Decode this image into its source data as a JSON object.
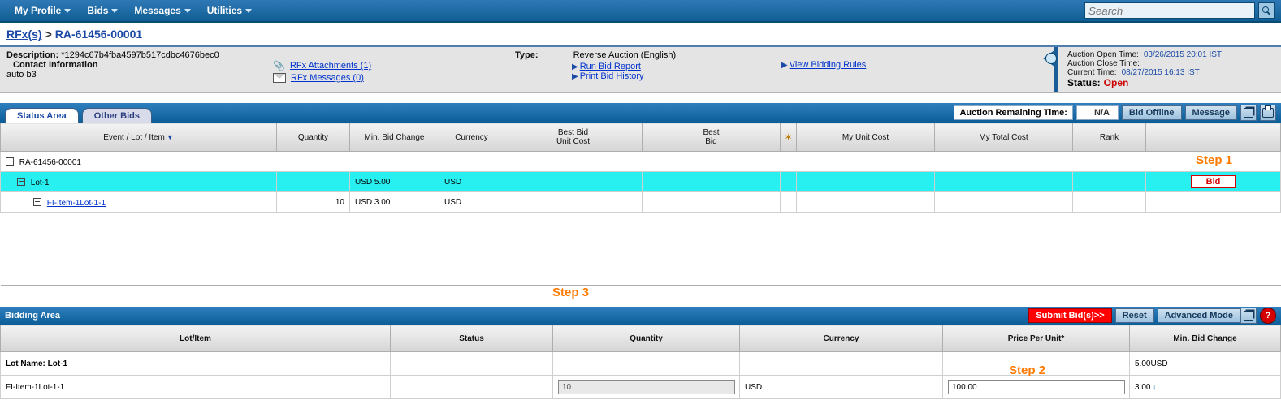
{
  "topnav": {
    "items": [
      "My Profile",
      "Bids",
      "Messages",
      "Utilities"
    ],
    "search_placeholder": "Search"
  },
  "breadcrumb": {
    "link": "RFx(s)",
    "current": "RA-61456-00001"
  },
  "info": {
    "description_label": "Description:",
    "description_value": "*1294c67b4fba4597b517cdbc4676bec0",
    "contact_label": "Contact Information",
    "contact_value": "auto b3",
    "rfx_attachments": "RFx Attachments (1)",
    "rfx_messages": "RFx Messages (0)",
    "type_label": "Type:",
    "type_value": "Reverse Auction (English)",
    "run_bid_report": "Run Bid Report",
    "print_bid_history": "Print Bid History",
    "view_bidding_rules": "View Bidding Rules"
  },
  "times": {
    "open_label": "Auction Open Time:",
    "open_value": "03/26/2015 20:01 IST",
    "close_label": "Auction Close Time:",
    "close_value": "",
    "current_label": "Current Time:",
    "current_value": "08/27/2015 16:13 IST",
    "status_label": "Status:",
    "status_value": "Open"
  },
  "tabs": {
    "status_area": "Status Area",
    "other_bids": "Other Bids"
  },
  "toolbar": {
    "remaining_label": "Auction Remaining Time:",
    "remaining_value": "N/A",
    "bid_offline": "Bid Offline",
    "message": "Message"
  },
  "grid": {
    "headers": {
      "event": "Event / Lot / Item",
      "quantity": "Quantity",
      "min_bid_change": "Min. Bid Change",
      "currency": "Currency",
      "best_bid_unit": "Best Bid\nUnit Cost",
      "best_bid": "Best\nBid",
      "my_unit": "My Unit Cost",
      "my_total": "My Total Cost",
      "rank": "Rank"
    },
    "rows": {
      "event_name": "RA-61456-00001",
      "lot_name": "Lot-1",
      "lot_min_bid": "USD 5.00",
      "lot_currency": "USD",
      "item_name": "FI-Item-1Lot-1-1",
      "item_qty": "10",
      "item_min_bid": "USD 3.00",
      "item_currency": "USD",
      "bid_button": "Bid"
    }
  },
  "annotations": {
    "step1": "Step 1",
    "step2": "Step 2",
    "step3": "Step 3"
  },
  "bidarea": {
    "title": "Bidding Area",
    "submit": "Submit Bid(s)>>",
    "reset": "Reset",
    "advanced": "Advanced Mode",
    "headers": {
      "lot_item": "Lot/Item",
      "status": "Status",
      "quantity": "Quantity",
      "currency": "Currency",
      "ppu": "Price Per Unit*",
      "min_bid": "Min. Bid Change"
    },
    "rows": {
      "lot_label": "Lot Name: Lot-1",
      "lot_min": "5.00USD",
      "item_label": "FI-Item-1Lot-1-1",
      "item_qty": "10",
      "item_cur": "USD",
      "item_ppu": "100.00",
      "item_min": "3.00"
    }
  }
}
